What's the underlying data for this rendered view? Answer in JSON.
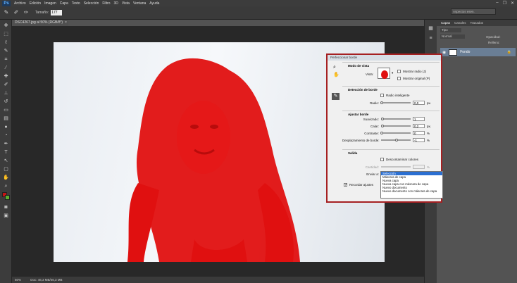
{
  "menu": {
    "logo": "Ps",
    "items": [
      "Archivo",
      "Edición",
      "Imagen",
      "Capa",
      "Texto",
      "Selección",
      "Filtro",
      "3D",
      "Vista",
      "Ventana",
      "Ayuda"
    ]
  },
  "window_controls": {
    "minimize": "–",
    "restore": "❐",
    "close": "✕"
  },
  "options_bar": {
    "tamano_label": "Tamaño:",
    "tamano_value": "177"
  },
  "search": {
    "placeholder": "Aspectos esen."
  },
  "document": {
    "tab_title": "DSC4267.jpg al 50% (RGB/8*)",
    "close": "×"
  },
  "status": {
    "zoom": "50%",
    "doc": "Doc: 46,3 MB/46,3 MB"
  },
  "panels": {
    "tabs": [
      "Capas",
      "Canales",
      "Trazados"
    ],
    "kind_filter": "Tipo",
    "blend_mode": "Normal",
    "opacity_label": "Opacidad:",
    "fill_label": "Relleno:",
    "layer_name": "Fondo"
  },
  "dialog": {
    "title": "Perfeccionar borde",
    "view_mode": {
      "header": "Modo de vista",
      "view_label": "Vista:",
      "show_radius": "Mostrar radio (J)",
      "show_original": "Mostrar original (P)"
    },
    "edge_detection": {
      "header": "Detección de borde",
      "smart_radius": "Radio inteligente",
      "radius_label": "Radio:",
      "radius_value": "0,0",
      "radius_unit": "px."
    },
    "adjust_edge": {
      "header": "Ajustar borde",
      "smooth_label": "Suavizado:",
      "smooth_value": "1",
      "feather_label": "Calar:",
      "feather_value": "0,2",
      "feather_unit": "px.",
      "contrast_label": "Contraste:",
      "contrast_value": "0",
      "contrast_unit": "%",
      "shift_label": "Desplazamiento de borde:",
      "shift_value": "-1",
      "shift_unit": "%"
    },
    "output": {
      "header": "Salida",
      "decontaminate": "Descontaminar colores",
      "amount_label": "Cantidad:",
      "amount_unit": "%",
      "output_to_label": "Enviar a:",
      "output_to_value": "Selección",
      "remember": "Recordar ajustes"
    },
    "dropdown_options": [
      "Selección",
      "Máscara de capa",
      "Nueva capa",
      "Nueva capa con máscara de capa",
      "Nuevo documento",
      "Nuevo documento con máscara de capa"
    ]
  },
  "colors": {
    "overlay_red": "#e01010",
    "dialog_border": "#a52022",
    "selected_option": "#2b6fd1"
  }
}
